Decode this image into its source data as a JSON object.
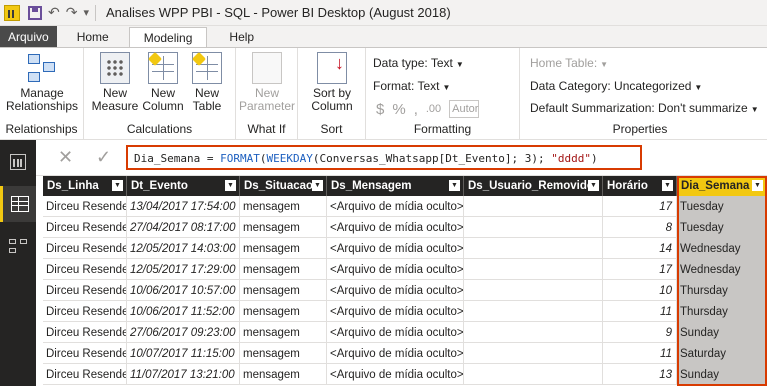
{
  "window": {
    "title": "Analises WPP PBI - SQL - Power BI Desktop (August 2018)"
  },
  "quick_access": {
    "dropdown_glyph": "▾"
  },
  "tabs": [
    {
      "label": "Arquivo"
    },
    {
      "label": "Home"
    },
    {
      "label": "Modeling"
    },
    {
      "label": "Help"
    }
  ],
  "ribbon": {
    "relationships": {
      "manage_label_1": "Manage",
      "manage_label_2": "Relationships",
      "group_label": "Relationships"
    },
    "calculations": {
      "new_measure_1": "New",
      "new_measure_2": "Measure",
      "new_column_1": "New",
      "new_column_2": "Column",
      "new_table_1": "New",
      "new_table_2": "Table",
      "group_label": "Calculations"
    },
    "whatif": {
      "new_parameter_1": "New",
      "new_parameter_2": "Parameter",
      "group_label": "What If"
    },
    "sort": {
      "sort_by_1": "Sort by",
      "sort_by_2": "Column",
      "group_label": "Sort"
    },
    "formatting": {
      "data_type": "Data type: Text",
      "format": "Format: Text",
      "currency": "$",
      "percent": "%",
      "comma": ",",
      "decimals": ".00",
      "auto": "Autor",
      "group_label": "Formatting"
    },
    "properties": {
      "home_table": "Home Table:",
      "data_category": "Data Category: Uncategorized",
      "default_summarization": "Default Summarization: Don't summarize",
      "group_label": "Properties"
    }
  },
  "formula_bar": {
    "cancel": "✕",
    "commit": "✓",
    "col": "Dia_Semana = ",
    "fn1": "FORMAT",
    "p1": "(",
    "fn2": "WEEKDAY",
    "p2": "(Conversas_Whatsapp[Dt_Evento]; 3); ",
    "str": "\"dddd\"",
    "p3": ")"
  },
  "table": {
    "columns": [
      "Ds_Linha",
      "Dt_Evento",
      "Ds_Situacao",
      "Ds_Mensagem",
      "Ds_Usuario_Removido",
      "Horário",
      "Dia_Semana"
    ],
    "rows": [
      [
        "Dirceu Resende",
        "13/04/2017 17:54:00",
        "mensagem",
        "<Arquivo de mídia oculto>",
        "",
        "17",
        "Tuesday"
      ],
      [
        "Dirceu Resende",
        "27/04/2017 08:17:00",
        "mensagem",
        "<Arquivo de mídia oculto>",
        "",
        "8",
        "Tuesday"
      ],
      [
        "Dirceu Resende",
        "12/05/2017 14:03:00",
        "mensagem",
        "<Arquivo de mídia oculto>",
        "",
        "14",
        "Wednesday"
      ],
      [
        "Dirceu Resende",
        "12/05/2017 17:29:00",
        "mensagem",
        "<Arquivo de mídia oculto>",
        "",
        "17",
        "Wednesday"
      ],
      [
        "Dirceu Resende",
        "10/06/2017 10:57:00",
        "mensagem",
        "<Arquivo de mídia oculto>",
        "",
        "10",
        "Thursday"
      ],
      [
        "Dirceu Resende",
        "10/06/2017 11:52:00",
        "mensagem",
        "<Arquivo de mídia oculto>",
        "",
        "11",
        "Thursday"
      ],
      [
        "Dirceu Resende",
        "27/06/2017 09:23:00",
        "mensagem",
        "<Arquivo de mídia oculto>",
        "",
        "9",
        "Sunday"
      ],
      [
        "Dirceu Resende",
        "10/07/2017 11:15:00",
        "mensagem",
        "<Arquivo de mídia oculto>",
        "",
        "11",
        "Saturday"
      ],
      [
        "Dirceu Resende",
        "11/07/2017 13:21:00",
        "mensagem",
        "<Arquivo de mídia oculto>",
        "",
        "13",
        "Sunday"
      ]
    ]
  },
  "colors": {
    "highlight": "#d83b01",
    "accent": "#f2c811"
  }
}
